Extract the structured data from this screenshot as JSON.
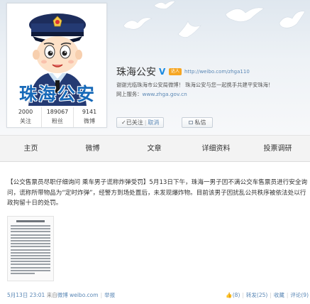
{
  "profile": {
    "avatar_name": "珠海公安",
    "name": "珠海公安",
    "verified_icon": "V",
    "vip_badge": "达人",
    "url": "http://weibo.com/zhga110",
    "bio_line1": "谢谢光临珠海市公安局微博！ 珠海公安与您一起携手共建平安珠海！",
    "bio_line2_prefix": "网上服务：",
    "bio_line2_link": "www.zhga.gov.cn",
    "follow_state": "✓已关注",
    "follow_cancel": "取消",
    "message_label": "私信"
  },
  "stats": [
    {
      "num": "2000",
      "label": "关注"
    },
    {
      "num": "189067",
      "label": "粉丝"
    },
    {
      "num": "9141",
      "label": "微博"
    }
  ],
  "tabs": [
    "主页",
    "微博",
    "文章",
    "详细资料",
    "投票调研"
  ],
  "post": {
    "text": "【公交售票员尽职仔细询问 乘车男子谎称炸弹受罚】5月13日下午，珠海一男子因不满公交车售票员进行安全询问，谎称所带物品为“定时炸弹”，经警方到场处置后，未发现爆炸物。目前该男子因扰乱公共秩序被依法处以行政拘留十日的处罚。",
    "time": "5月13日 23:01",
    "source_prefix": "来自",
    "source": "微博 weibo.com",
    "report": "举报",
    "like": "(8)",
    "repost": "转发(25)",
    "favorite": "收藏",
    "comment": "评论(9)"
  },
  "colors": {
    "accent_blue": "#1769b8",
    "link_blue": "#5a87b5",
    "tab_bg": "#f3f3f3"
  },
  "icons": {
    "avatar": "police-cartoon-icon",
    "birds": "white-dove-icon",
    "verified": "verified-v-icon",
    "message": "envelope-icon",
    "like": "thumbs-up-icon"
  }
}
